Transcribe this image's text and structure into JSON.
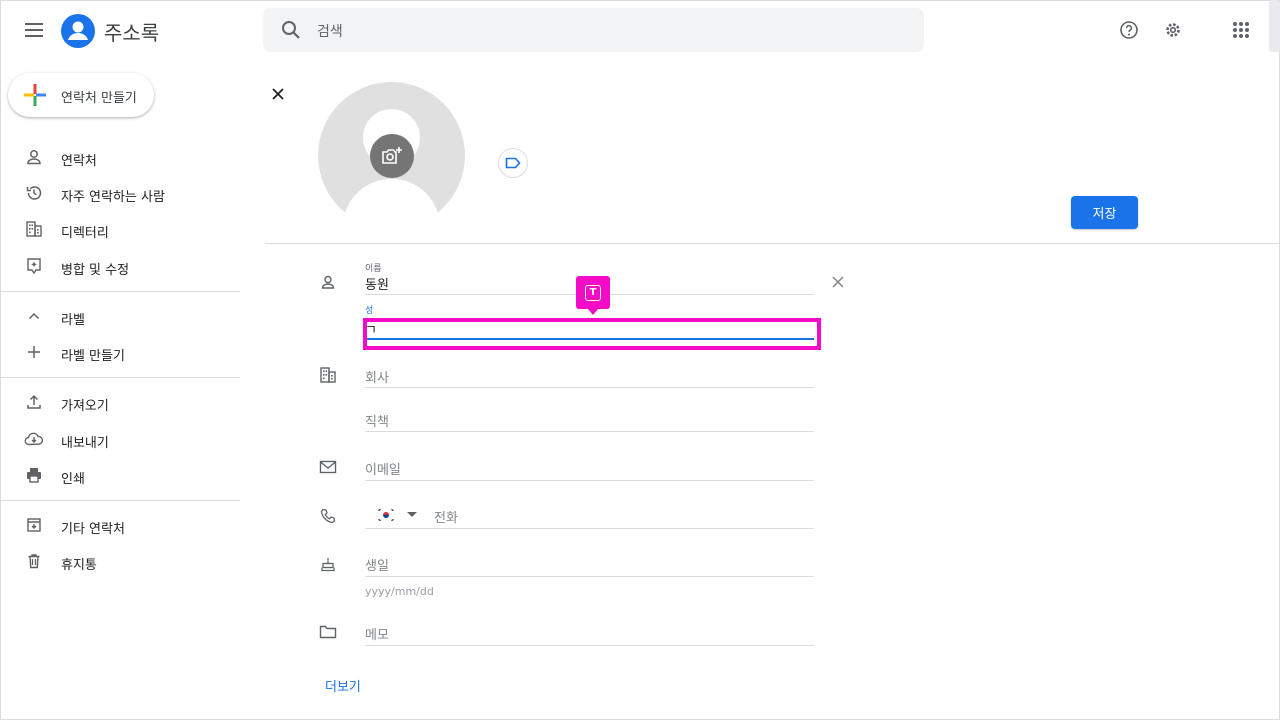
{
  "header": {
    "app_title": "주소록",
    "search_placeholder": "검색",
    "icons": [
      "menu-icon",
      "contacts-logo-icon",
      "search-icon",
      "help-icon",
      "settings-icon",
      "apps-grid-icon"
    ]
  },
  "sidebar": {
    "create_label": "연락처 만들기",
    "items": [
      {
        "label": "연락처",
        "icon": "person-icon"
      },
      {
        "label": "자주 연락하는 사람",
        "icon": "history-icon"
      },
      {
        "label": "디렉터리",
        "icon": "building-icon"
      },
      {
        "label": "병합 및 수정",
        "icon": "merge-fix-icon"
      },
      {
        "label": "라벨",
        "icon": "chevron-up-icon"
      },
      {
        "label": "라벨 만들기",
        "icon": "plus-icon"
      },
      {
        "label": "가져오기",
        "icon": "upload-icon"
      },
      {
        "label": "내보내기",
        "icon": "cloud-download-icon"
      },
      {
        "label": "인쇄",
        "icon": "print-icon"
      },
      {
        "label": "기타 연락처",
        "icon": "archive-icon"
      },
      {
        "label": "휴지통",
        "icon": "trash-icon"
      }
    ]
  },
  "form": {
    "save_label": "저장",
    "first_name": {
      "label": "이름",
      "value": "동원"
    },
    "last_name": {
      "label": "성",
      "value": "ㄱ"
    },
    "company": {
      "placeholder": "회사"
    },
    "job_title": {
      "placeholder": "직책"
    },
    "email": {
      "placeholder": "이메일"
    },
    "phone": {
      "placeholder": "전화",
      "country": "KR"
    },
    "birthday": {
      "placeholder": "생일",
      "hint": "yyyy/mm/dd"
    },
    "notes": {
      "placeholder": "메모"
    },
    "more_label": "더보기"
  },
  "highlight": {
    "color": "#f40bc8",
    "marker_glyph": "T"
  },
  "colors": {
    "accent": "#1a73e8",
    "highlight": "#f40bc8"
  }
}
